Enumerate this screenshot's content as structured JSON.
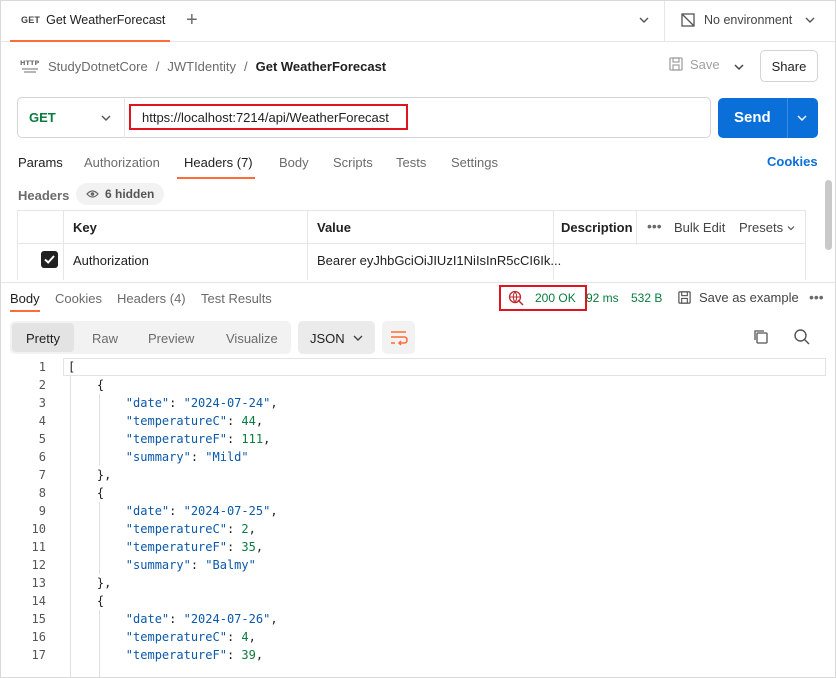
{
  "tab": {
    "method": "GET",
    "name": "Get WeatherForecast"
  },
  "environment": {
    "label": "No environment"
  },
  "breadcrumb": {
    "parts": [
      "StudyDotnetCore",
      "JWTIdentity",
      "Get WeatherForecast"
    ],
    "separator": "/"
  },
  "toolbar": {
    "save_label": "Save",
    "share_label": "Share"
  },
  "request": {
    "method": "GET",
    "url": "https://localhost:7214/api/WeatherForecast",
    "send_label": "Send"
  },
  "request_tabs": [
    "Params",
    "Authorization",
    "Headers (7)",
    "Body",
    "Scripts",
    "Tests",
    "Settings"
  ],
  "cookies_label": "Cookies",
  "headers_section": {
    "label": "Headers",
    "hidden_label": "6 hidden",
    "columns": {
      "key": "Key",
      "value": "Value",
      "description": "Description"
    },
    "bulk_edit": "Bulk Edit",
    "presets": "Presets",
    "rows": [
      {
        "key": "Authorization",
        "value": "Bearer eyJhbGciOiJIUzI1NiIsInR5cCI6Ik...",
        "checked": true
      }
    ]
  },
  "response": {
    "tabs": [
      "Body",
      "Cookies",
      "Headers (4)",
      "Test Results"
    ],
    "status": "200 OK",
    "time": "92 ms",
    "size": "532 B",
    "save_example": "Save as example",
    "views": [
      "Pretty",
      "Raw",
      "Preview",
      "Visualize"
    ],
    "format": "JSON"
  },
  "code_lines": [
    {
      "n": "1",
      "t": "["
    },
    {
      "n": "2",
      "t": "    {"
    },
    {
      "n": "3",
      "key": "\"date\"",
      "val": "\"2024-07-24\"",
      "vt": "s"
    },
    {
      "n": "4",
      "key": "\"temperatureC\"",
      "val": "44",
      "vt": "n"
    },
    {
      "n": "5",
      "key": "\"temperatureF\"",
      "val": "111",
      "vt": "n"
    },
    {
      "n": "6",
      "key": "\"summary\"",
      "val": "\"Mild\"",
      "vt": "s",
      "last": true
    },
    {
      "n": "7",
      "t": "    },"
    },
    {
      "n": "8",
      "t": "    {"
    },
    {
      "n": "9",
      "key": "\"date\"",
      "val": "\"2024-07-25\"",
      "vt": "s"
    },
    {
      "n": "10",
      "key": "\"temperatureC\"",
      "val": "2",
      "vt": "n"
    },
    {
      "n": "11",
      "key": "\"temperatureF\"",
      "val": "35",
      "vt": "n"
    },
    {
      "n": "12",
      "key": "\"summary\"",
      "val": "\"Balmy\"",
      "vt": "s",
      "last": true
    },
    {
      "n": "13",
      "t": "    },"
    },
    {
      "n": "14",
      "t": "    {"
    },
    {
      "n": "15",
      "key": "\"date\"",
      "val": "\"2024-07-26\"",
      "vt": "s"
    },
    {
      "n": "16",
      "key": "\"temperatureC\"",
      "val": "4",
      "vt": "n"
    },
    {
      "n": "17",
      "key": "\"temperatureF\"",
      "val": "39",
      "vt": "n"
    }
  ],
  "colors": {
    "accent": "#ff6c37",
    "send": "#0a6fd8",
    "success": "#0a7c3f",
    "highlight": "#e0141e"
  }
}
